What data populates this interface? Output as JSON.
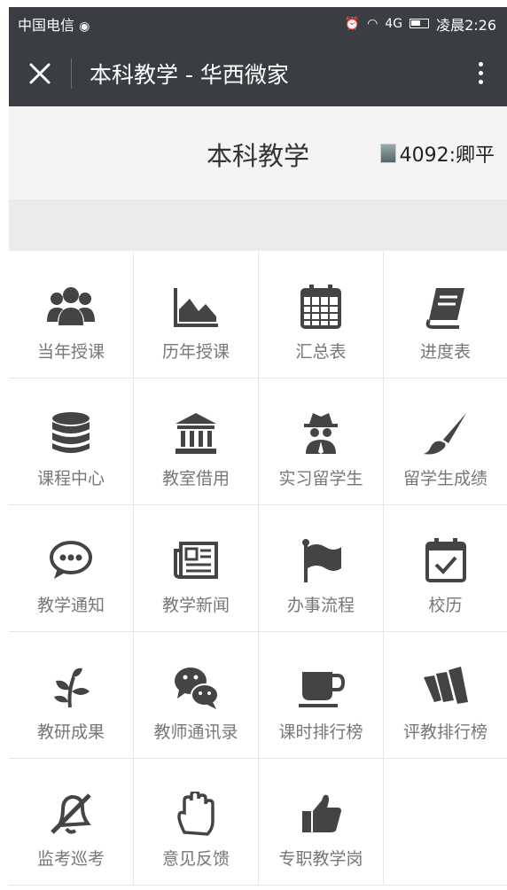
{
  "status_bar": {
    "carrier": "中国电信",
    "time": "凌晨2:26",
    "network": "4G"
  },
  "nav": {
    "title": "本科教学 - 华西微家"
  },
  "header": {
    "title": "本科教学",
    "user": "4092:卿平"
  },
  "menu": [
    {
      "label": "当年授课",
      "icon": "users-icon"
    },
    {
      "label": "历年授课",
      "icon": "area-chart-icon"
    },
    {
      "label": "汇总表",
      "icon": "calendar-grid-icon"
    },
    {
      "label": "进度表",
      "icon": "book-icon"
    },
    {
      "label": "课程中心",
      "icon": "database-icon"
    },
    {
      "label": "教室借用",
      "icon": "bank-icon"
    },
    {
      "label": "实习留学生",
      "icon": "spy-icon"
    },
    {
      "label": "留学生成绩",
      "icon": "paint-brush-icon"
    },
    {
      "label": "教学通知",
      "icon": "chat-bubble-icon"
    },
    {
      "label": "教学新闻",
      "icon": "newspaper-icon"
    },
    {
      "label": "办事流程",
      "icon": "flag-icon"
    },
    {
      "label": "校历",
      "icon": "calendar-check-icon"
    },
    {
      "label": "教研成果",
      "icon": "leaf-icon"
    },
    {
      "label": "教师通讯录",
      "icon": "wechat-icon"
    },
    {
      "label": "课时排行榜",
      "icon": "coffee-cup-icon"
    },
    {
      "label": "评教排行榜",
      "icon": "fork-logo-icon"
    },
    {
      "label": "监考巡考",
      "icon": "bell-slash-icon"
    },
    {
      "label": "意见反馈",
      "icon": "hand-icon"
    },
    {
      "label": "专职教学岗",
      "icon": "thumbs-up-icon"
    }
  ]
}
